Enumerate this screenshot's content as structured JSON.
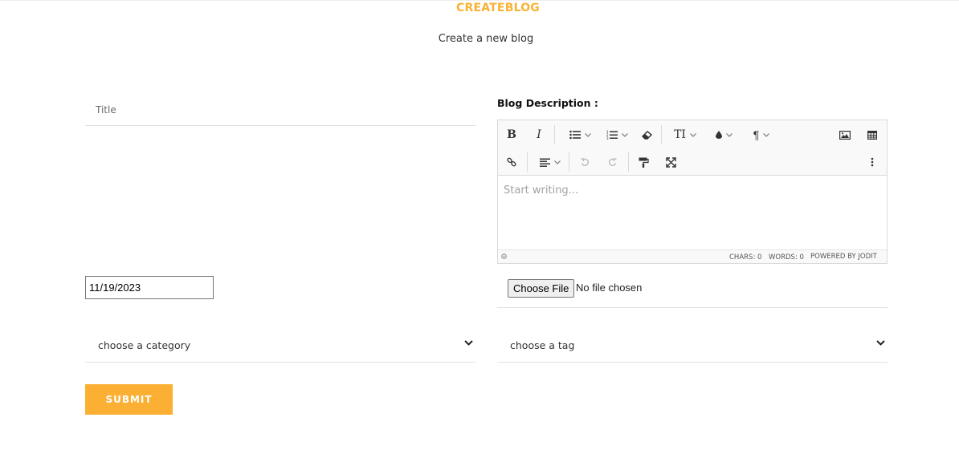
{
  "header": {
    "title": "CREATEBLOG",
    "subtitle": "Create a new blog"
  },
  "form": {
    "title_placeholder": "Title",
    "description_label": "Blog Description :",
    "editor": {
      "placeholder": "Start writing...",
      "toolbar_row1": [
        "bold-icon",
        "italic-icon",
        "unordered-list-icon",
        "ordered-list-icon",
        "eraser-icon",
        "font-size-icon",
        "color-icon",
        "paragraph-icon",
        "image-icon",
        "table-icon"
      ],
      "toolbar_row2": [
        "link-icon",
        "align-icon",
        "undo-icon",
        "redo-icon",
        "paint-format-icon",
        "fullsize-icon",
        "more-icon"
      ],
      "bold_glyph": "B",
      "italic_glyph": "I",
      "fontsize_glyph": "TI",
      "paragraph_glyph": "¶",
      "chars": "CHARS: 0",
      "words": "WORDS: 0",
      "powered_by": "POWERED BY JODIT"
    },
    "date_value": "11/19/2023",
    "file": {
      "button_label": "Choose File",
      "status": "No file chosen"
    },
    "category_select": "choose a category",
    "tag_select": "choose a tag",
    "submit_label": "SUBMIT"
  },
  "colors": {
    "accent": "#fbb034",
    "heading": "#f9b234"
  }
}
